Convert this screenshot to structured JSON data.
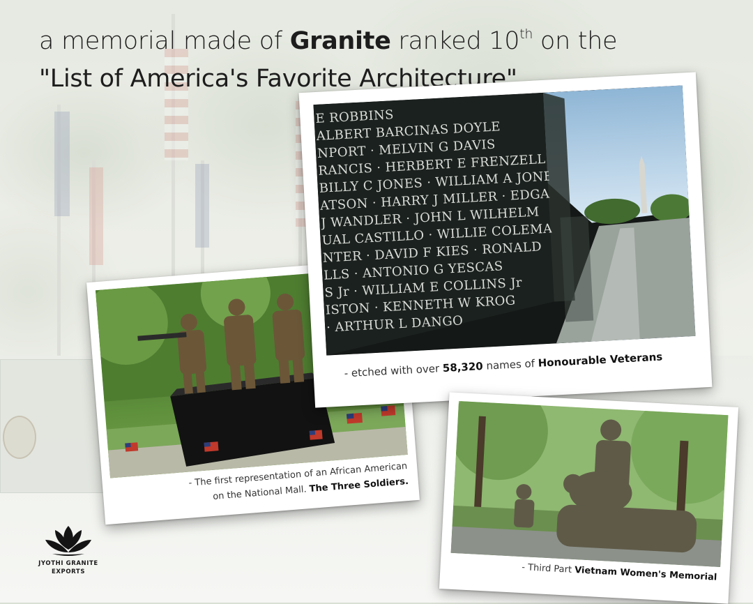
{
  "heading": {
    "line1_pre": "a memorial made of ",
    "line1_bold": "Granite",
    "line1_mid": " ranked 10",
    "line1_sup": "th",
    "line1_post": " on the",
    "line2": "\"List of America's Favorite Architecture\""
  },
  "cards": {
    "wall": {
      "caption_pre": "- etched with over ",
      "caption_number": "58,320",
      "caption_mid": " names of ",
      "caption_bold": "Honourable Veterans",
      "engraved_names": [
        "E ROBBINS",
        "ALBERT BARCINAS DOYLE",
        "NPORT · MELVIN G DAVIS",
        "RANCIS · HERBERT E FRENZELL",
        "BILLY C JONES · WILLIAM A JONES",
        "ATSON · HARRY J MILLER · EDGAR E",
        "J WANDLER · JOHN L WILHELM",
        "UAL CASTILLO · WILLIE COLEMAN",
        "NTER · DAVID F KIES · RONALD",
        "LLS · ANTONIO G YESCAS",
        "S Jr · WILLIAM E COLLINS Jr",
        "ISTON · KENNETH W KROG",
        "· ARTHUR L DANGO"
      ]
    },
    "soldiers": {
      "caption_line1": "- The first representation of an African American",
      "caption_line2_pre": "on the National Mall. ",
      "caption_line2_bold": "The Three Soldiers."
    },
    "women": {
      "caption_pre": "- Third Part ",
      "caption_bold": "Vietnam Women's Memorial"
    }
  },
  "logo": {
    "line1": "JYOTHI GRANITE",
    "line2": "EXPORTS"
  },
  "colors": {
    "heading_text": "#1d1d1d",
    "card_bg": "#ffffff",
    "caption_text": "#333333",
    "granite_black": "#121614",
    "foliage_green": "#5e8c3e",
    "sky_blue": "#bcd6ec",
    "flag_red": "#c0392b",
    "flag_blue": "#2c3e7a",
    "bronze": "#6b5638"
  }
}
